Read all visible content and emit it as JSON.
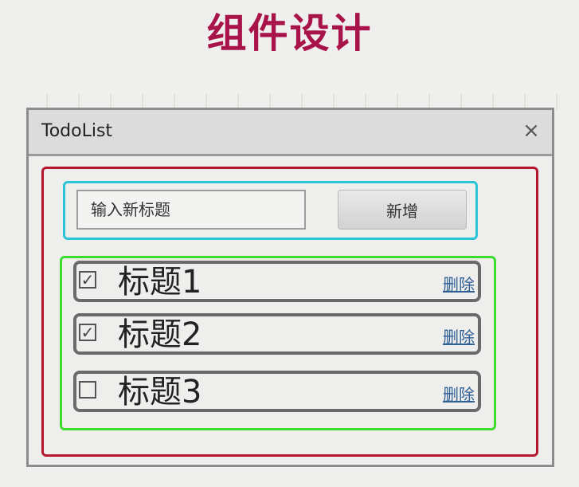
{
  "slide": {
    "title": "组件设计"
  },
  "window": {
    "title": "TodoList",
    "close_symbol": "×"
  },
  "header": {
    "input_placeholder": "输入新标题",
    "add_button_label": "新增"
  },
  "todos": [
    {
      "title": "标题1",
      "checked": true,
      "delete_label": "删除"
    },
    {
      "title": "标题2",
      "checked": true,
      "delete_label": "删除"
    },
    {
      "title": "标题3",
      "checked": false,
      "delete_label": "删除"
    }
  ],
  "icons": {
    "checked": "check-icon",
    "close": "close-icon"
  },
  "colors": {
    "slide_title": "#a8134a",
    "app_box_border": "#b5162e",
    "header_box_border": "#2bc4d8",
    "list_box_border": "#3ddc2f",
    "item_border": "#6a6a6a",
    "delete_link": "#2f5f95"
  }
}
